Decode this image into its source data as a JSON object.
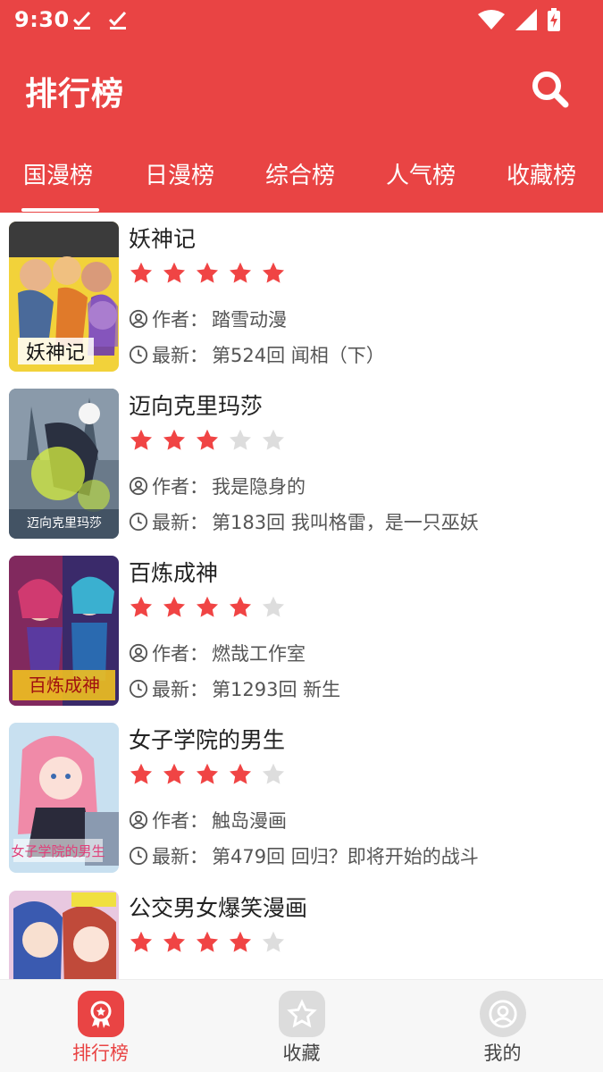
{
  "status": {
    "time": "9:30"
  },
  "appbar": {
    "title": "排行榜"
  },
  "tabs": [
    {
      "label": "国漫榜",
      "active": true
    },
    {
      "label": "日漫榜",
      "active": false
    },
    {
      "label": "综合榜",
      "active": false
    },
    {
      "label": "人气榜",
      "active": false
    },
    {
      "label": "收藏榜",
      "active": false
    }
  ],
  "labels": {
    "author": "作者：",
    "latest": "最新："
  },
  "comics": [
    {
      "title": "妖神记",
      "rating": 5,
      "author": "踏雪动漫",
      "latest": "第524回 闻相（下）"
    },
    {
      "title": "迈向克里玛莎",
      "rating": 3,
      "author": "我是隐身的",
      "latest": "第183回 我叫格雷，是一只巫妖"
    },
    {
      "title": "百炼成神",
      "rating": 4,
      "author": "燃哉工作室",
      "latest": "第1293回 新生"
    },
    {
      "title": "女子学院的男生",
      "rating": 4,
      "author": "触岛漫画",
      "latest": "第479回 回归？即将开始的战斗"
    },
    {
      "title": "公交男女爆笑漫画",
      "rating": 4,
      "author": "",
      "latest": ""
    }
  ],
  "bottomnav": [
    {
      "label": "排行榜",
      "icon": "ranking-icon",
      "active": true
    },
    {
      "label": "收藏",
      "icon": "star-icon",
      "active": false
    },
    {
      "label": "我的",
      "icon": "user-icon",
      "active": false
    }
  ],
  "colors": {
    "brand": "#e94444",
    "star_on": "#f04444",
    "star_off": "#dddddd"
  }
}
